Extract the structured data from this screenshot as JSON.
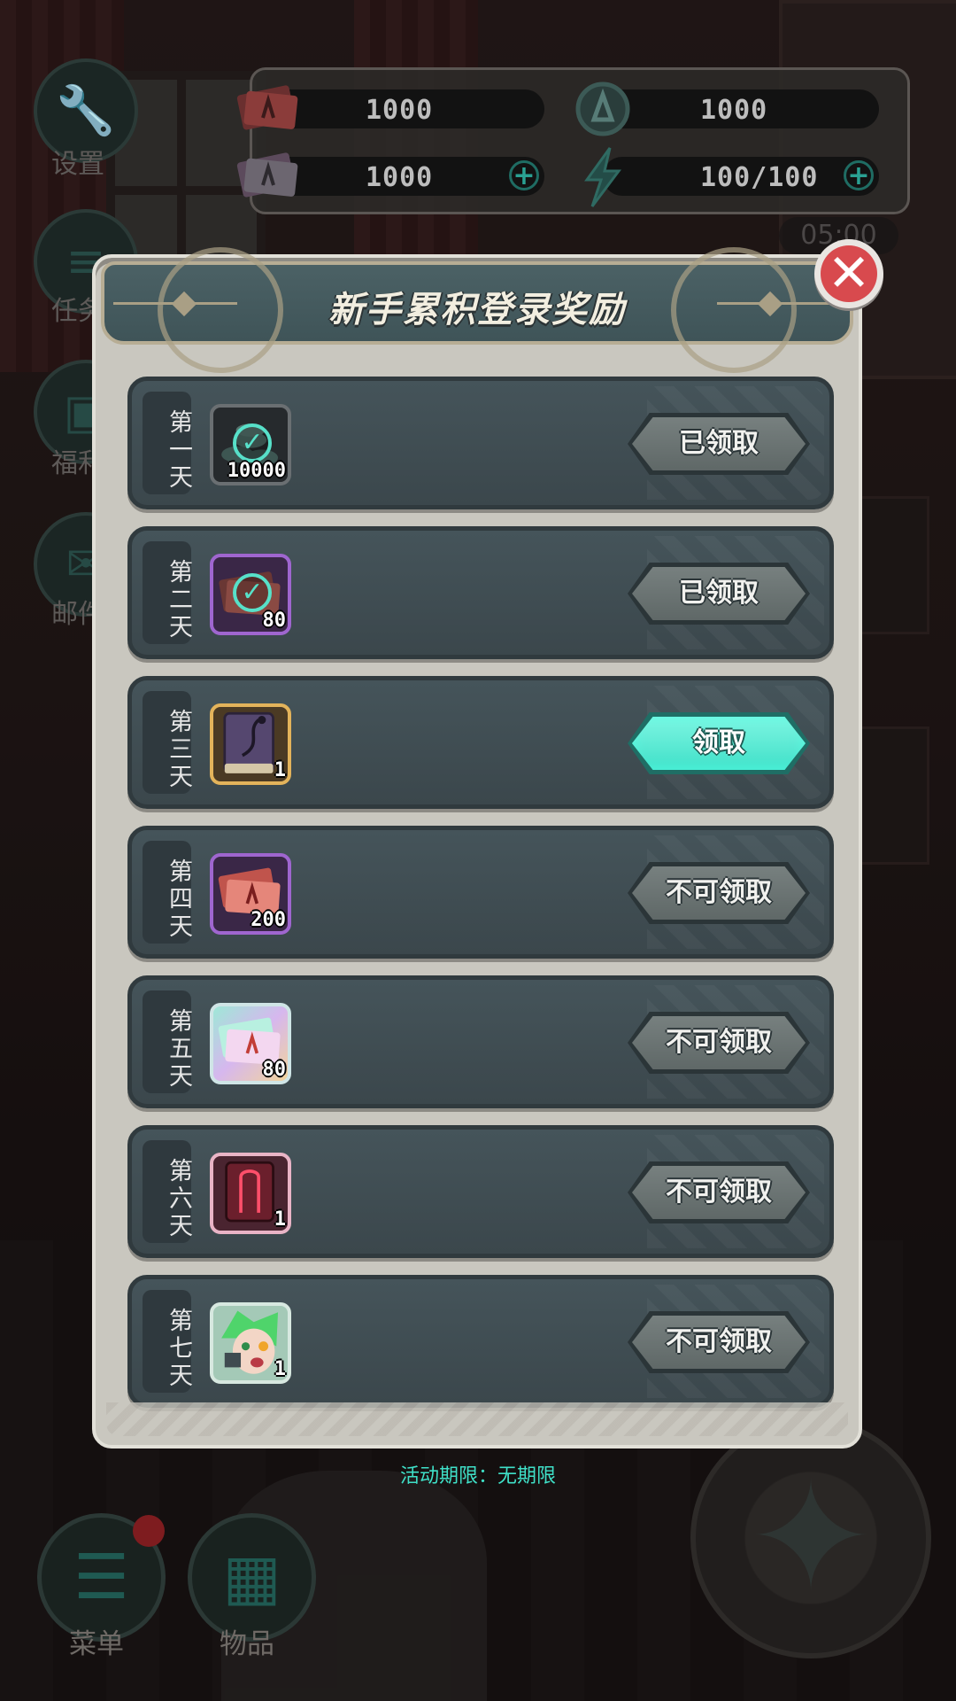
{
  "resources": [
    {
      "name": "red-ticket",
      "value": "1000",
      "has_plus": false
    },
    {
      "name": "emblem-currency",
      "value": "1000",
      "has_plus": false
    },
    {
      "name": "holo-ticket",
      "value": "1000",
      "has_plus": true
    },
    {
      "name": "energy",
      "value": "100/100",
      "has_plus": true
    }
  ],
  "timer": "05:00",
  "side_menu": {
    "settings": "设置",
    "tasks": "任务",
    "welfare": "福利",
    "mail": "邮件"
  },
  "bottom_menu": {
    "menu": "菜单",
    "items": "物品"
  },
  "modal": {
    "title": "新手累积登录奖励",
    "footer": "活动期限：无期限",
    "rows": [
      {
        "day": "第一天",
        "qty": "10000",
        "status": "已领取",
        "icon": "coin-stack-icon",
        "frame": "gray",
        "claimed": true
      },
      {
        "day": "第二天",
        "qty": "80",
        "status": "已领取",
        "icon": "red-ticket-icon",
        "frame": "purple",
        "claimed": true
      },
      {
        "day": "第三天",
        "qty": "1",
        "status": "领取",
        "icon": "spellbook-icon",
        "frame": "gold",
        "claimed": false,
        "active": true
      },
      {
        "day": "第四天",
        "qty": "200",
        "status": "不可领取",
        "icon": "red-ticket-icon",
        "frame": "purple",
        "claimed": false
      },
      {
        "day": "第五天",
        "qty": "80",
        "status": "不可领取",
        "icon": "holo-ticket-icon",
        "frame": "holo",
        "claimed": false
      },
      {
        "day": "第六天",
        "qty": "1",
        "status": "不可领取",
        "icon": "crimson-book-icon",
        "frame": "pink",
        "claimed": false
      },
      {
        "day": "第七天",
        "qty": "1",
        "status": "不可领取",
        "icon": "character-portrait-icon",
        "frame": "teal",
        "claimed": false
      }
    ]
  },
  "colors": {
    "accent": "#3fe0c8",
    "close_red": "#d84a4e",
    "row_bg": "#3f4b50"
  }
}
